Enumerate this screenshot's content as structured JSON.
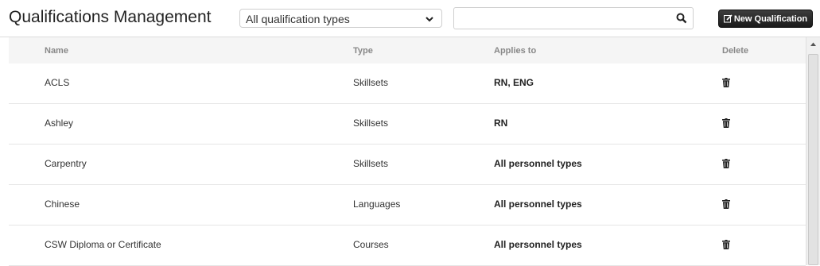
{
  "header": {
    "title": "Qualifications Management",
    "filter_selected": "All qualification types",
    "search_value": "",
    "new_button_label": "New Qualification"
  },
  "table": {
    "columns": [
      "Name",
      "Type",
      "Applies to",
      "Delete"
    ],
    "rows": [
      {
        "name": "ACLS",
        "type": "Skillsets",
        "applies_to": "RN, ENG"
      },
      {
        "name": "Ashley",
        "type": "Skillsets",
        "applies_to": "RN"
      },
      {
        "name": "Carpentry",
        "type": "Skillsets",
        "applies_to": "All personnel types"
      },
      {
        "name": "Chinese",
        "type": "Languages",
        "applies_to": "All personnel types"
      },
      {
        "name": "CSW Diploma or Certificate",
        "type": "Courses",
        "applies_to": "All personnel types"
      }
    ]
  },
  "icons": {
    "filter": "chevron-down-icon",
    "search": "search-icon",
    "new": "edit-icon",
    "delete": "trash-icon"
  },
  "colors": {
    "button_bg": "#222222",
    "header_bg": "#f5f5f5"
  }
}
